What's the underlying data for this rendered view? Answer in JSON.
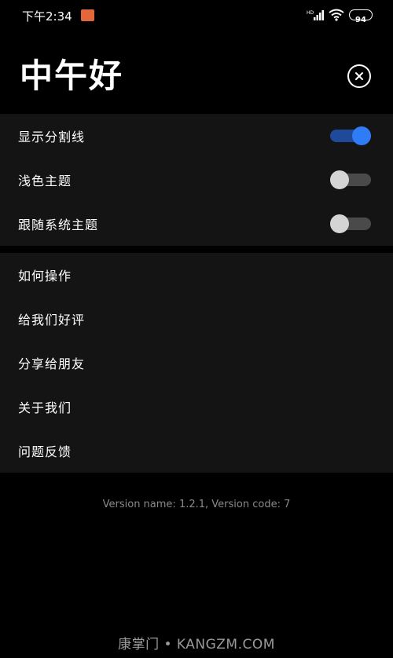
{
  "status_bar": {
    "time": "下午2:34",
    "battery": "94",
    "icons": [
      "app-notification-icon",
      "signal-icon",
      "wifi-icon",
      "battery-icon"
    ]
  },
  "header": {
    "greeting": "中午好",
    "close_icon": "close-circle-icon"
  },
  "settings": {
    "toggles": [
      {
        "label": "显示分割线",
        "enabled": true
      },
      {
        "label": "浅色主题",
        "enabled": false
      },
      {
        "label": "跟随系统主题",
        "enabled": false
      }
    ],
    "links": [
      {
        "label": "如何操作"
      },
      {
        "label": "给我们好评"
      },
      {
        "label": "分享给朋友"
      },
      {
        "label": "关于我们"
      },
      {
        "label": "问题反馈"
      }
    ]
  },
  "version": "Version name: 1.2.1, Version code: 7",
  "watermark": "康掌门 • KANGZM.COM",
  "colors": {
    "background": "#000000",
    "section": "#141414",
    "toggle_on_knob": "#2f7cf6",
    "toggle_on_track": "#1f4a9a",
    "toggle_off_knob": "#d4d4d4",
    "toggle_off_track": "#4a4a4a"
  }
}
